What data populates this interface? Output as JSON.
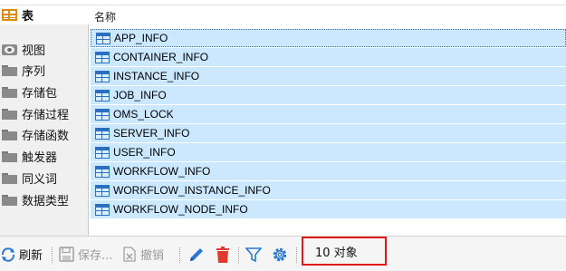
{
  "sidebar": {
    "items": [
      {
        "label": "表",
        "icon": "table-icon",
        "active": true
      },
      {
        "label": "视图",
        "icon": "view-icon"
      },
      {
        "label": "序列",
        "icon": "folder-icon"
      },
      {
        "label": "存储包",
        "icon": "folder-icon"
      },
      {
        "label": "存储过程",
        "icon": "folder-icon"
      },
      {
        "label": "存储函数",
        "icon": "folder-icon"
      },
      {
        "label": "触发器",
        "icon": "folder-icon"
      },
      {
        "label": "同义词",
        "icon": "folder-icon"
      },
      {
        "label": "数据类型",
        "icon": "folder-icon"
      }
    ]
  },
  "list": {
    "column_header": "名称",
    "rows": [
      "APP_INFO",
      "CONTAINER_INFO",
      "INSTANCE_INFO",
      "JOB_INFO",
      "OMS_LOCK",
      "SERVER_INFO",
      "USER_INFO",
      "WORKFLOW_INFO",
      "WORKFLOW_INSTANCE_INFO",
      "WORKFLOW_NODE_INFO"
    ]
  },
  "toolbar": {
    "refresh_label": "刷新",
    "save_label": "保存...",
    "undo_label": "撤销",
    "status_text": "10 对象"
  },
  "colors": {
    "selection": "#cce8ff",
    "table_icon_blue": "#2a6fc0",
    "active_icon_orange": "#e08a12",
    "highlight_red": "#e01818",
    "delete_red": "#e03a2f",
    "pencil_blue": "#2a78d4"
  }
}
